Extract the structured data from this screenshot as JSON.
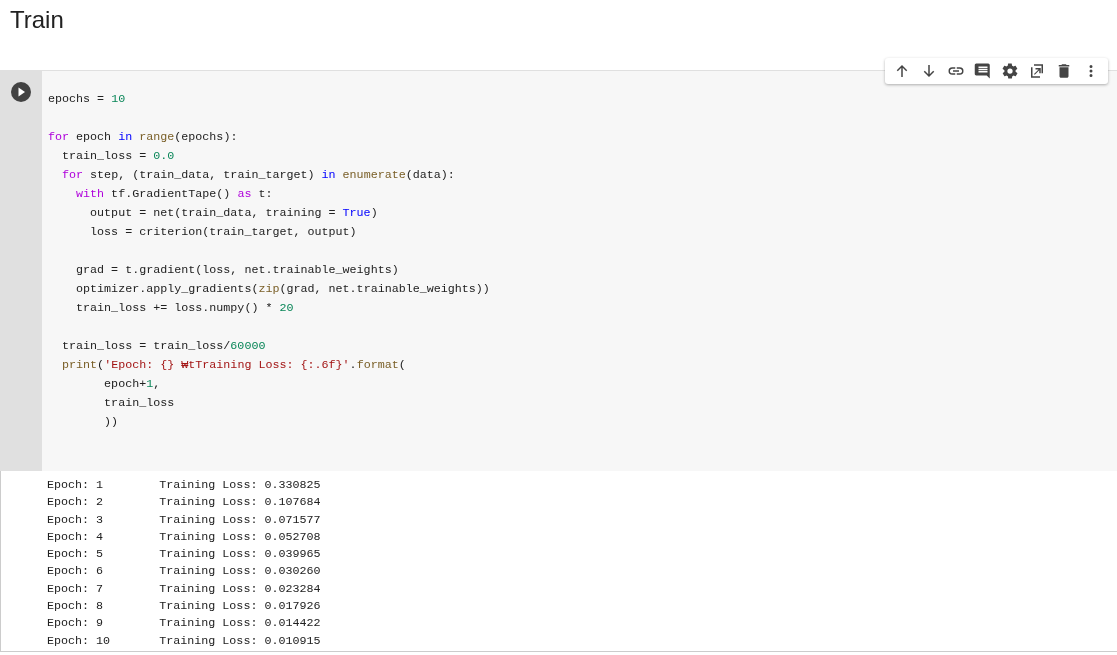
{
  "section_title": "Train",
  "cell": {
    "code_blocks": [
      [
        [
          {
            "kind": "plain",
            "t": "epochs = "
          },
          {
            "kind": "number",
            "t": "10"
          }
        ]
      ],
      [
        [
          {
            "kind": "keyword",
            "t": "for"
          },
          {
            "kind": "plain",
            "t": " epoch "
          },
          {
            "kind": "operator",
            "t": "in"
          },
          {
            "kind": "builtin",
            "t": " range"
          },
          {
            "kind": "plain",
            "t": "(epochs):"
          }
        ],
        [
          {
            "kind": "plain",
            "t": "  train_loss = "
          },
          {
            "kind": "number",
            "t": "0.0"
          }
        ],
        [
          {
            "kind": "keyword",
            "t": "  for"
          },
          {
            "kind": "plain",
            "t": " step, (train_data, train_target) "
          },
          {
            "kind": "operator",
            "t": "in"
          },
          {
            "kind": "builtin",
            "t": " enumerate"
          },
          {
            "kind": "plain",
            "t": "(data):"
          }
        ],
        [
          {
            "kind": "keyword",
            "t": "    with"
          },
          {
            "kind": "plain",
            "t": " tf.GradientTape() "
          },
          {
            "kind": "keyword",
            "t": "as"
          },
          {
            "kind": "plain",
            "t": " t:"
          }
        ],
        [
          {
            "kind": "plain",
            "t": "      output = net(train_data, training = "
          },
          {
            "kind": "operator",
            "t": "True"
          },
          {
            "kind": "plain",
            "t": ")"
          }
        ],
        [
          {
            "kind": "plain",
            "t": "      loss = criterion(train_target, output)"
          }
        ]
      ],
      [
        [
          {
            "kind": "plain",
            "t": "    grad = t.gradient(loss, net.trainable_weights)"
          }
        ],
        [
          {
            "kind": "plain",
            "t": "    optimizer.apply_gradients("
          },
          {
            "kind": "builtin",
            "t": "zip"
          },
          {
            "kind": "plain",
            "t": "(grad, net.trainable_weights))"
          }
        ],
        [
          {
            "kind": "plain",
            "t": "    train_loss += loss.numpy() * "
          },
          {
            "kind": "number",
            "t": "20"
          }
        ]
      ],
      [
        [
          {
            "kind": "plain",
            "t": "  train_loss = train_loss/"
          },
          {
            "kind": "number",
            "t": "60000"
          }
        ],
        [
          {
            "kind": "builtin",
            "t": "  print"
          },
          {
            "kind": "plain",
            "t": "("
          },
          {
            "kind": "string",
            "t": "'Epoch: {} ₩tTraining Loss: {:.6f}'"
          },
          {
            "kind": "plain",
            "t": "."
          },
          {
            "kind": "builtin",
            "t": "format"
          },
          {
            "kind": "plain",
            "t": "("
          }
        ],
        [
          {
            "kind": "plain",
            "t": "        epoch+"
          },
          {
            "kind": "number",
            "t": "1"
          },
          {
            "kind": "plain",
            "t": ","
          }
        ],
        [
          {
            "kind": "plain",
            "t": "        train_loss"
          }
        ],
        [
          {
            "kind": "plain",
            "t": "        ))"
          }
        ]
      ]
    ],
    "output_lines": [
      "Epoch: 1\tTraining Loss: 0.330825",
      "Epoch: 2\tTraining Loss: 0.107684",
      "Epoch: 3\tTraining Loss: 0.071577",
      "Epoch: 4\tTraining Loss: 0.052708",
      "Epoch: 5\tTraining Loss: 0.039965",
      "Epoch: 6\tTraining Loss: 0.030260",
      "Epoch: 7\tTraining Loss: 0.023284",
      "Epoch: 8\tTraining Loss: 0.017926",
      "Epoch: 9\tTraining Loss: 0.014422",
      "Epoch: 10\tTraining Loss: 0.010915"
    ]
  },
  "toolbar": [
    {
      "kind": "up"
    },
    {
      "kind": "down"
    },
    {
      "kind": "link"
    },
    {
      "kind": "comment"
    },
    {
      "kind": "settings"
    },
    {
      "kind": "mirror"
    },
    {
      "kind": "delete"
    },
    {
      "kind": "more"
    }
  ]
}
